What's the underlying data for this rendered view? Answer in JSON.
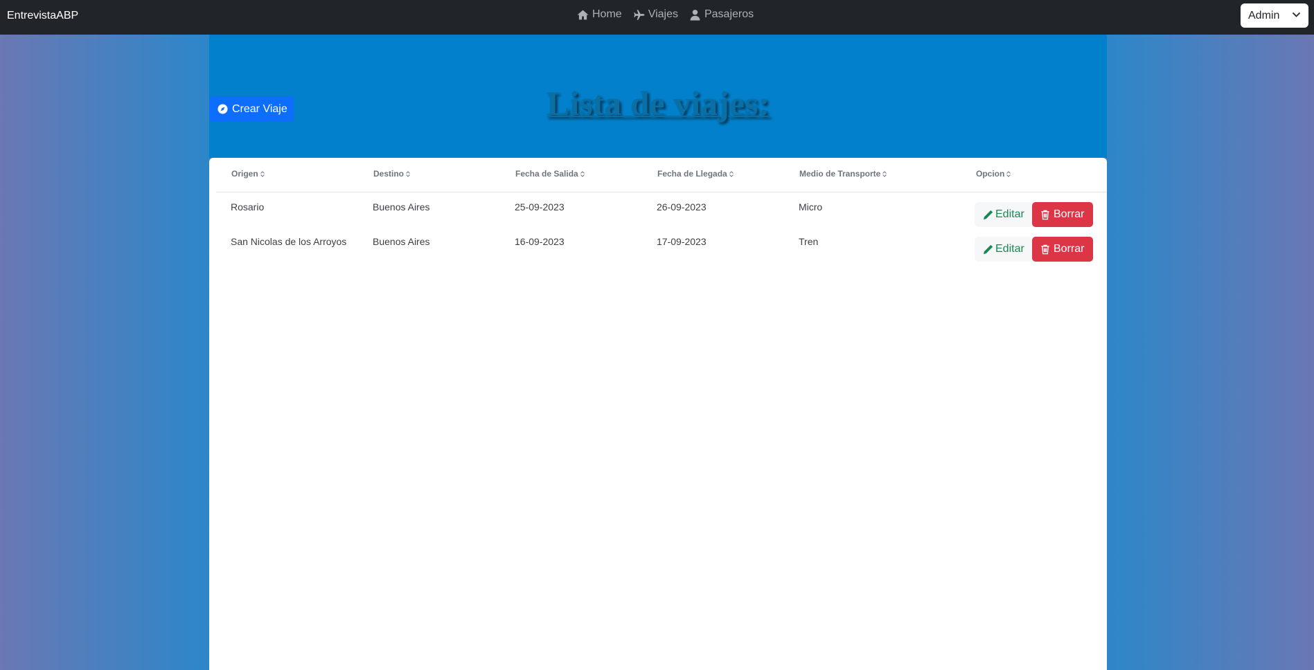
{
  "navbar": {
    "brand": "EntrevistaABP",
    "links": [
      {
        "label": "Home",
        "icon": "home-icon"
      },
      {
        "label": "Viajes",
        "icon": "plane-icon"
      },
      {
        "label": "Pasajeros",
        "icon": "user-icon"
      }
    ],
    "user_select": {
      "value": "Admin"
    }
  },
  "page": {
    "title": "Lista de viajes:",
    "create_button": "Crear Viaje"
  },
  "table": {
    "columns": [
      "Origen",
      "Destino",
      "Fecha de Salida",
      "Fecha de Llegada",
      "Medio de Transporte",
      "Opcion"
    ],
    "rows": [
      {
        "origen": "Rosario",
        "destino": "Buenos Aires",
        "salida": "25-09-2023",
        "llegada": "26-09-2023",
        "medio": "Micro"
      },
      {
        "origen": "San Nicolas de los Arroyos",
        "destino": "Buenos Aires",
        "salida": "16-09-2023",
        "llegada": "17-09-2023",
        "medio": "Tren"
      }
    ],
    "edit_label": "Editar",
    "delete_label": "Borrar"
  },
  "colors": {
    "navbar": "#212529",
    "primary": "#0d6efd",
    "danger": "#dc3545",
    "success": "#198754",
    "hero": "#0280cb"
  }
}
